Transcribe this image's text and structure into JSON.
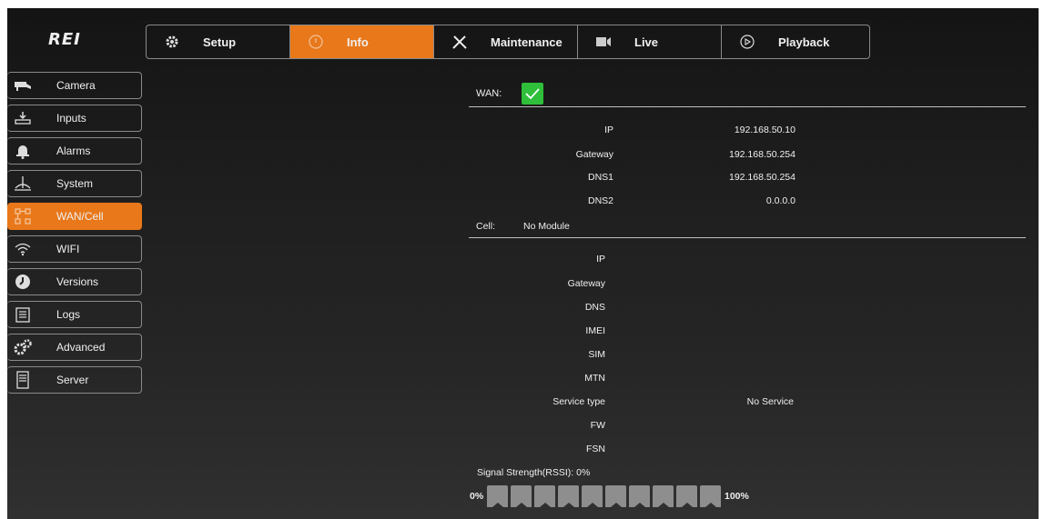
{
  "logo": "REI",
  "nav": {
    "tabs": [
      {
        "label": "Setup",
        "icon": "gear-icon"
      },
      {
        "label": "Info",
        "icon": "info-icon"
      },
      {
        "label": "Maintenance",
        "icon": "tools-icon"
      },
      {
        "label": "Live",
        "icon": "camera-icon"
      },
      {
        "label": "Playback",
        "icon": "play-icon"
      }
    ],
    "active": "Info"
  },
  "sidebar": {
    "items": [
      {
        "label": "Camera",
        "icon": "camera-icon"
      },
      {
        "label": "Inputs",
        "icon": "inputs-icon"
      },
      {
        "label": "Alarms",
        "icon": "bell-icon"
      },
      {
        "label": "System",
        "icon": "system-icon"
      },
      {
        "label": "WAN/Cell",
        "icon": "network-icon"
      },
      {
        "label": "WIFI",
        "icon": "wifi-icon"
      },
      {
        "label": "Versions",
        "icon": "versions-icon"
      },
      {
        "label": "Logs",
        "icon": "logs-icon"
      },
      {
        "label": "Advanced",
        "icon": "gears-icon"
      },
      {
        "label": "Server",
        "icon": "server-icon"
      }
    ],
    "active": "WAN/Cell"
  },
  "wan": {
    "label": "WAN:",
    "enabled": true,
    "rows": [
      {
        "label": "IP",
        "value": "192.168.50.10"
      },
      {
        "label": "Gateway",
        "value": "192.168.50.254"
      },
      {
        "label": "DNS1",
        "value": "192.168.50.254"
      },
      {
        "label": "DNS2",
        "value": "0.0.0.0"
      }
    ]
  },
  "cell": {
    "label": "Cell:",
    "status": "No Module",
    "rows": [
      {
        "label": "IP",
        "value": ""
      },
      {
        "label": "Gateway",
        "value": ""
      },
      {
        "label": "DNS",
        "value": ""
      },
      {
        "label": "IMEI",
        "value": ""
      },
      {
        "label": "SIM",
        "value": ""
      },
      {
        "label": "MTN",
        "value": ""
      },
      {
        "label": "Service type",
        "value": "No Service"
      },
      {
        "label": "FW",
        "value": ""
      },
      {
        "label": "FSN",
        "value": ""
      }
    ]
  },
  "signal": {
    "label": "Signal Strength(RSSI): 0%",
    "min_label": "0%",
    "max_label": "100%",
    "value": 0
  },
  "colors": {
    "accent": "#e8781a",
    "check": "#2fbf3a"
  }
}
